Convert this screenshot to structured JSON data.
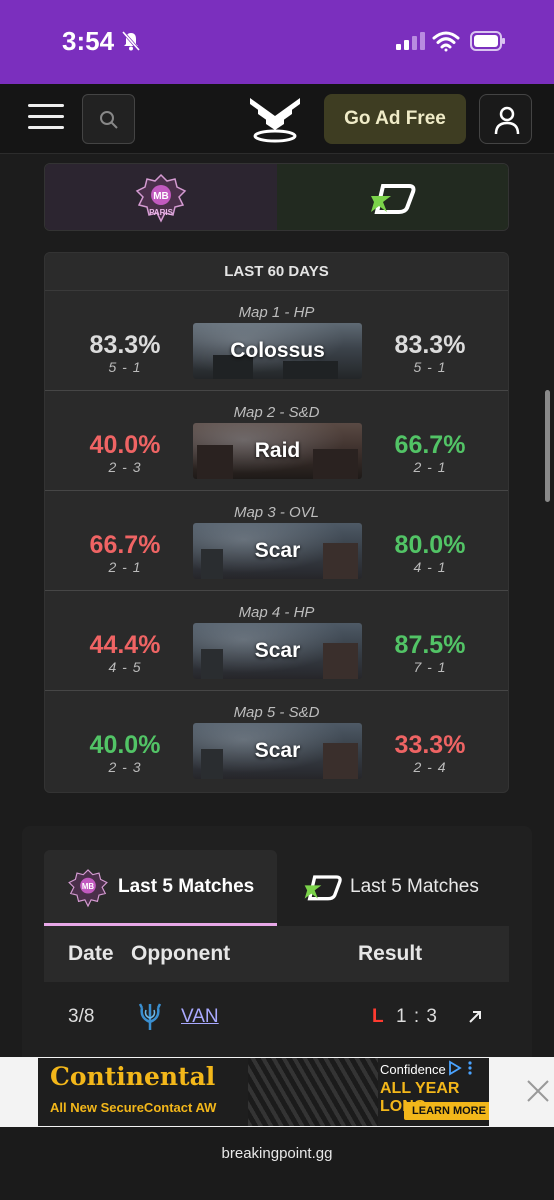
{
  "status_bar": {
    "time": "3:54"
  },
  "nav": {
    "ad_free_label": "Go Ad Free"
  },
  "stats_panel": {
    "title": "LAST 60 DAYS",
    "maps": [
      {
        "label": "Map 1 - HP",
        "map": "Colossus",
        "left_pct": "83.3%",
        "left_record": "5 - 1",
        "left_color": "#dcdcdc",
        "right_pct": "83.3%",
        "right_record": "5 - 1",
        "right_color": "#dcdcdc"
      },
      {
        "label": "Map 2 - S&D",
        "map": "Raid",
        "left_pct": "40.0%",
        "left_record": "2 - 3",
        "left_color": "#ef6464",
        "right_pct": "66.7%",
        "right_record": "2 - 1",
        "right_color": "#52c466"
      },
      {
        "label": "Map 3 - OVL",
        "map": "Scar",
        "left_pct": "66.7%",
        "left_record": "2 - 1",
        "left_color": "#ef6464",
        "right_pct": "80.0%",
        "right_record": "4 - 1",
        "right_color": "#52c466"
      },
      {
        "label": "Map 4 - HP",
        "map": "Scar",
        "left_pct": "44.4%",
        "left_record": "4 - 5",
        "left_color": "#ef6464",
        "right_pct": "87.5%",
        "right_record": "7 - 1",
        "right_color": "#52c466"
      },
      {
        "label": "Map 5 - S&D",
        "map": "Scar",
        "left_pct": "40.0%",
        "left_record": "2 - 3",
        "left_color": "#52c466",
        "right_pct": "33.3%",
        "right_record": "2 - 4",
        "right_color": "#ef6464"
      }
    ]
  },
  "matches": {
    "tab_left": "Last 5 Matches",
    "tab_right": "Last 5 Matches",
    "headers": {
      "date": "Date",
      "opponent": "Opponent",
      "result": "Result"
    },
    "rows": [
      {
        "date": "3/8",
        "opponent": "VAN",
        "outcome": "L",
        "score": "1 : 3"
      }
    ]
  },
  "ad": {
    "brand": "Continental",
    "subline": "All New SecureContact AW",
    "confidence": "Confidence",
    "tagline": "ALL YEAR LONG.",
    "cta": "LEARN MORE"
  },
  "browser": {
    "url": "breakingpoint.gg"
  },
  "colors": {
    "accent_purple": "#7b2fbe",
    "win_green": "#52c466",
    "loss_red": "#ef6464",
    "tab_underline": "#e8a8e8"
  }
}
